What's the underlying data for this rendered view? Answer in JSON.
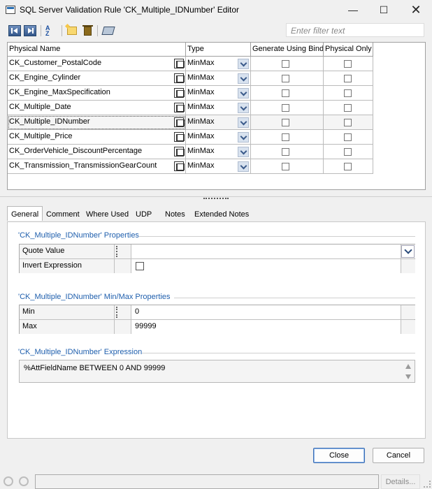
{
  "window": {
    "title": "SQL Server Validation Rule 'CK_Multiple_IDNumber' Editor",
    "controls": [
      "minimize",
      "maximize",
      "close"
    ]
  },
  "toolbar": {
    "buttons": [
      "first-record-icon",
      "last-record-icon",
      "sort-icon",
      "new-icon",
      "delete-icon",
      "properties-icon"
    ],
    "filter_placeholder": "Enter filter text"
  },
  "grid": {
    "columns": [
      "Physical Name",
      "Type",
      "Generate Using Bind",
      "Physical Only"
    ],
    "rows": [
      {
        "name": "CK_Customer_PostalCode",
        "type": "MinMax",
        "bind": false,
        "physical_only": false
      },
      {
        "name": "CK_Engine_Cylinder",
        "type": "MinMax",
        "bind": false,
        "physical_only": false
      },
      {
        "name": "CK_Engine_MaxSpecification",
        "type": "MinMax",
        "bind": false,
        "physical_only": false
      },
      {
        "name": "CK_Multiple_Date",
        "type": "MinMax",
        "bind": false,
        "physical_only": false
      },
      {
        "name": "CK_Multiple_IDNumber",
        "type": "MinMax",
        "bind": false,
        "physical_only": false,
        "selected": true
      },
      {
        "name": "CK_Multiple_Price",
        "type": "MinMax",
        "bind": false,
        "physical_only": false
      },
      {
        "name": "CK_OrderVehicle_DiscountPercentage",
        "type": "MinMax",
        "bind": false,
        "physical_only": false
      },
      {
        "name": "CK_Transmission_TransmissionGearCount",
        "type": "MinMax",
        "bind": false,
        "physical_only": false
      }
    ]
  },
  "tabs": [
    "General",
    "Comment",
    "Where Used",
    "UDP",
    "Notes",
    "Extended Notes"
  ],
  "active_tab": "General",
  "properties": {
    "title": "'CK_Multiple_IDNumber' Properties",
    "rows": [
      {
        "label": "Quote Value",
        "value": ""
      },
      {
        "label": "Invert Expression",
        "checked": false
      }
    ]
  },
  "minmax": {
    "title": "'CK_Multiple_IDNumber' Min/Max Properties",
    "rows": [
      {
        "label": "Min",
        "value": "0"
      },
      {
        "label": "Max",
        "value": "99999"
      }
    ]
  },
  "expression": {
    "title": "'CK_Multiple_IDNumber' Expression",
    "text": "%AttFieldName BETWEEN 0 AND 99999"
  },
  "buttons": {
    "close": "Close",
    "cancel": "Cancel"
  },
  "status": {
    "details": "Details..."
  }
}
